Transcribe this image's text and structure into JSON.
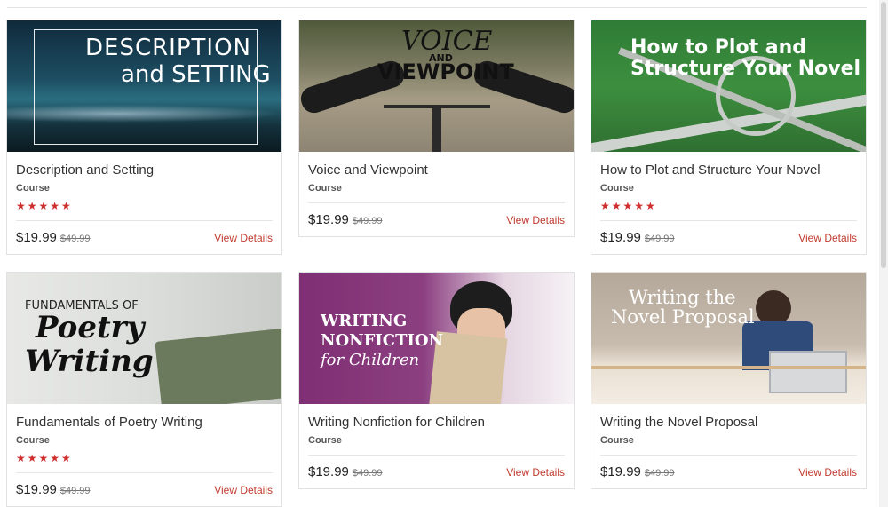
{
  "courses": [
    {
      "thumb_lines": [
        "DESCRIPTION",
        "and SETTING"
      ],
      "title": "Description and Setting",
      "type": "Course",
      "stars": "★★★★★",
      "price": "$19.99",
      "old_price": "$49.99",
      "details": "View Details"
    },
    {
      "thumb_lines": [
        "VOICE",
        "AND",
        "VIEWPOINT"
      ],
      "title": "Voice and Viewpoint",
      "type": "Course",
      "price": "$19.99",
      "old_price": "$49.99",
      "details": "View Details"
    },
    {
      "thumb_lines": [
        "How to Plot and",
        "Structure Your Novel"
      ],
      "title": "How to Plot and Structure Your Novel",
      "type": "Course",
      "stars": "★★★★★",
      "price": "$19.99",
      "old_price": "$49.99",
      "details": "View Details"
    },
    {
      "thumb_lines": [
        "FUNDAMENTALS OF",
        "Poetry",
        "Writing"
      ],
      "title": "Fundamentals of Poetry Writing",
      "type": "Course",
      "stars": "★★★★★",
      "price": "$19.99",
      "old_price": "$49.99",
      "details": "View Details"
    },
    {
      "thumb_lines": [
        "WRITING",
        "NONFICTION",
        "for Children"
      ],
      "title": "Writing Nonfiction for Children",
      "type": "Course",
      "price": "$19.99",
      "old_price": "$49.99",
      "details": "View Details"
    },
    {
      "thumb_lines": [
        "Writing the",
        "Novel Proposal"
      ],
      "title": "Writing the Novel Proposal",
      "type": "Course",
      "price": "$19.99",
      "old_price": "$49.99",
      "details": "View Details"
    }
  ],
  "colors": {
    "accent": "#c13b2f",
    "star": "#cf2e2e"
  }
}
